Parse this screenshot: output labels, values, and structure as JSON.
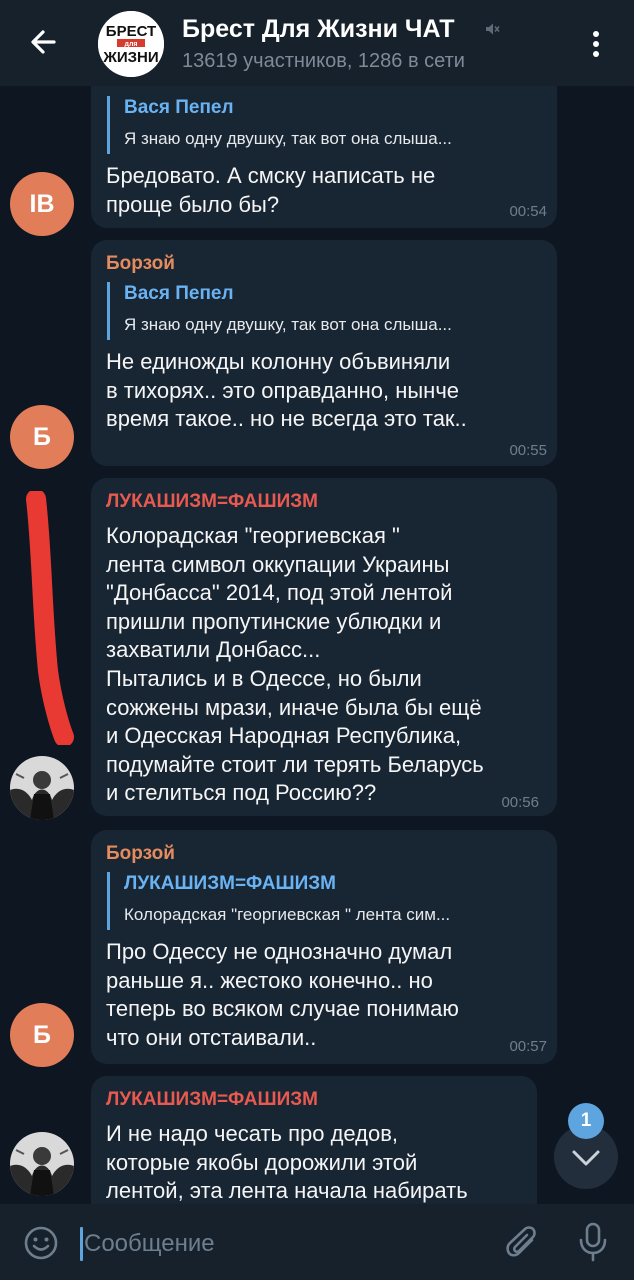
{
  "header": {
    "title": "Брест Для Жизни ЧАТ",
    "subtitle": "13619 участников, 1286 в сети",
    "logo": {
      "line1": "БРЕСТ",
      "line2": "для",
      "line3": "ЖИЗНИ"
    },
    "icons": {
      "back": "arrow-left-icon",
      "mute": "muted-speaker-icon",
      "menu": "more-vertical-icon"
    }
  },
  "colors": {
    "background": "#0e1621",
    "header": "#17212b",
    "bubble": "#182533",
    "accent": "#5ea5e0",
    "sender_orange": "#e58c5e",
    "sender_red": "#e85a4f",
    "avatar_orange": "#e17d58",
    "annotation_stroke": "#e83a33"
  },
  "messages": [
    {
      "reply": {
        "name": "Вася Пепел",
        "text": "Я знаю одну двушку, так вот она слыша..."
      },
      "text": "Бредовато. А смску написать не\nпроще было бы?",
      "time": "00:54",
      "avatar": "IB"
    },
    {
      "sender": "Борзой",
      "reply": {
        "name": "Вася Пепел",
        "text": "Я знаю одну двушку, так вот она слыша..."
      },
      "text": "Не единожды колонну объвиняли\nв тихорях.. это оправданно, нынче\nвремя такое.. но не всегда это так..",
      "time": "00:55",
      "avatar": "Б"
    },
    {
      "sender": "ЛУКАШИЗМ=ФАШИЗМ",
      "text": "Колорадская \"георгиевская \"\nлента символ оккупации Украины\n\"Донбасса\" 2014, под этой лентой\nпришли пропутинские ублюдки и\nзахватили Донбасс...\nПытались и в Одессе, но были\nсожжены мрази, иначе была бы ещё\nи Одесская Народная Республика,\nподумайте стоит ли терять Беларусь\nи стелиться под Россию??",
      "time": "00:56"
    },
    {
      "sender": "Борзой",
      "reply": {
        "name": "ЛУКАШИЗМ=ФАШИЗМ",
        "text": "Колорадская \"георгиевская \" лента сим..."
      },
      "text": "Про Одессу не однозначно думал\nраньше я.. жестоко конечно.. но\nтеперь во всяком случае понимаю\nчто они отстаивали..",
      "time": "00:57",
      "avatar": "Б"
    },
    {
      "sender": "ЛУКАШИЗМ=ФАШИЗМ",
      "text": "И не надо чесать про дедов,\nкоторые якобы дорожили этой\nлентой, эта лента начала набирать"
    }
  ],
  "scroll_down": {
    "unread_count": "1",
    "icon": "chevron-down-icon"
  },
  "composer": {
    "placeholder": "Сообщение",
    "icons": {
      "emoji": "emoji-smile-icon",
      "attach": "paperclip-icon",
      "mic": "microphone-icon"
    }
  }
}
